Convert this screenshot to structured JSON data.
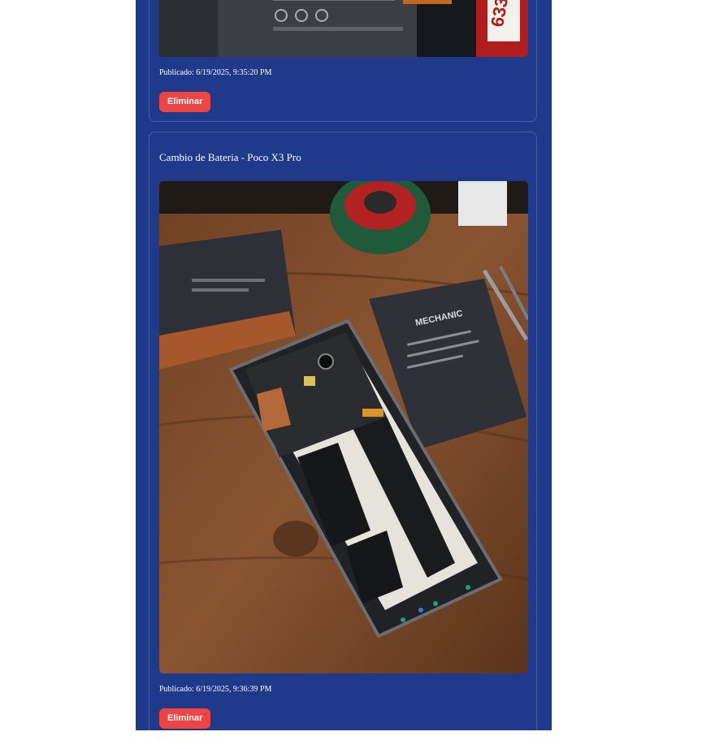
{
  "posts": [
    {
      "published": "Publicado: 6/19/2025, 9:35:20 PM",
      "delete_label": "Eliminar",
      "image_label": "633"
    },
    {
      "title": "Cambio de Bateria - Poco X3 Pro",
      "published": "Publicado: 6/19/2025, 9:36:39 PM",
      "delete_label": "Eliminar",
      "image_label": "MECHANIC"
    }
  ],
  "colors": {
    "page_background": "#ffffff",
    "column_background": "#1f3a8a",
    "delete_button": "#ef4444",
    "text": "#ffffff"
  }
}
